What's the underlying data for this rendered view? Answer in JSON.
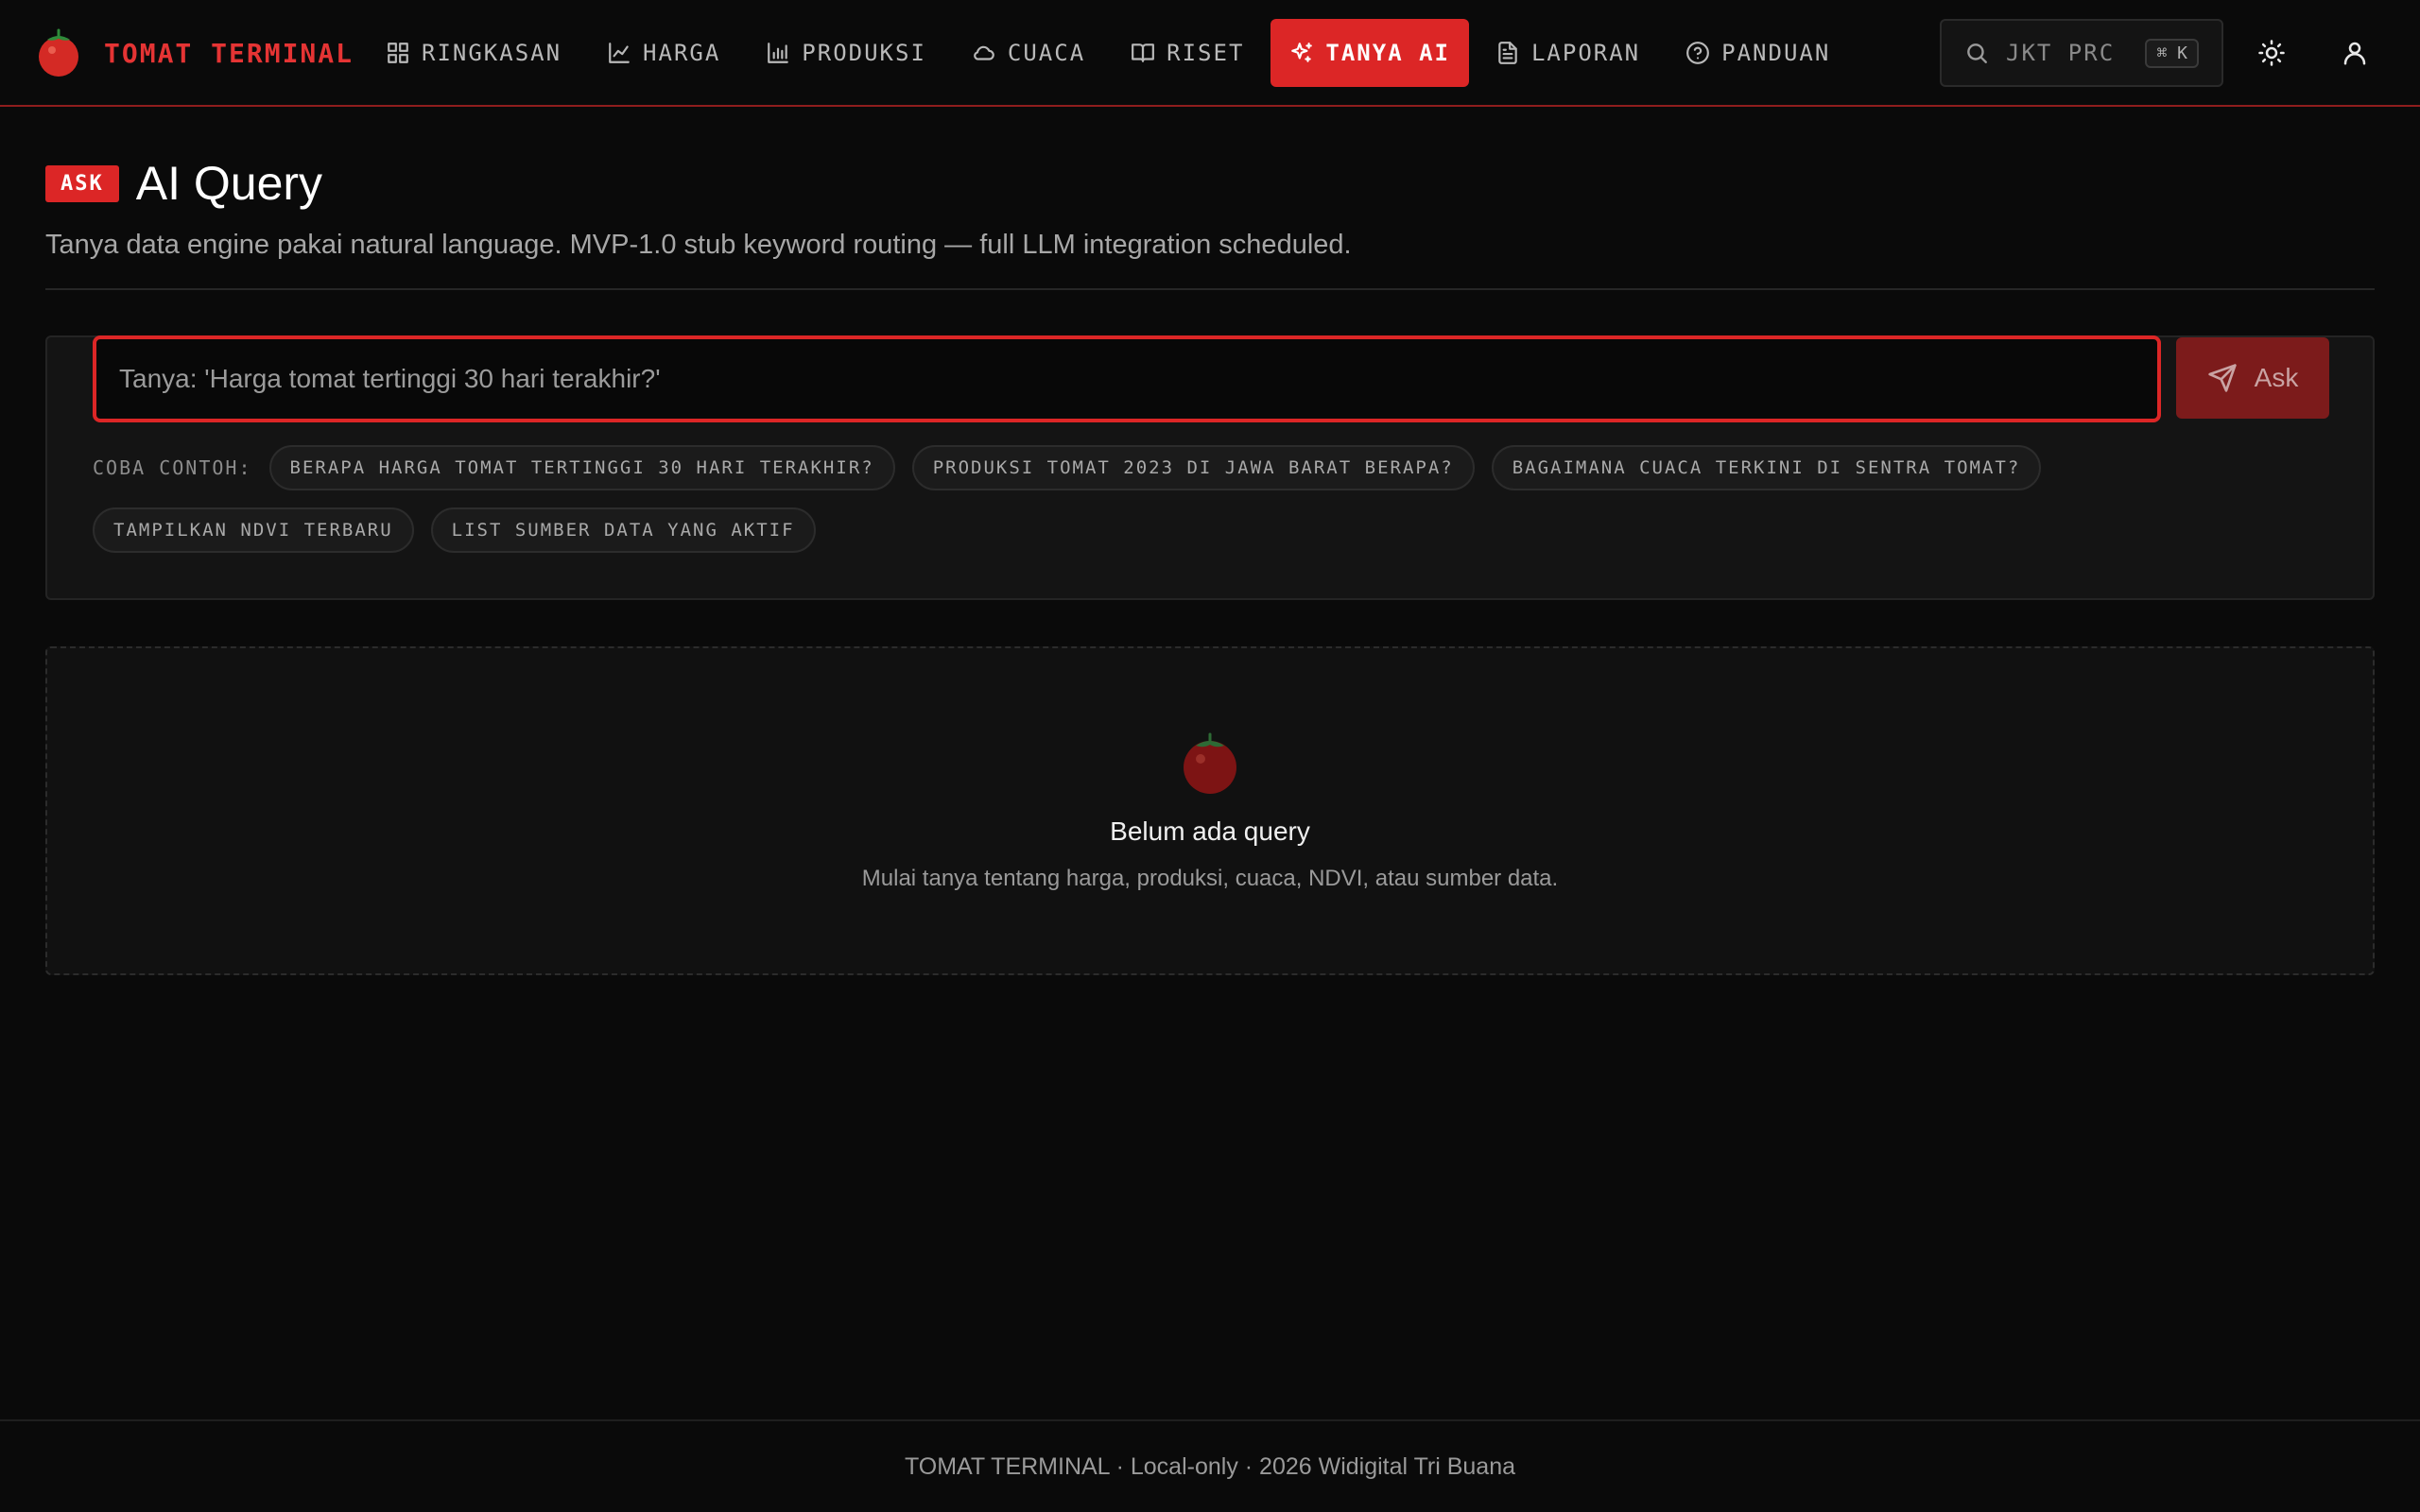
{
  "brand": {
    "name": "TOMAT TERMINAL",
    "icon": "tomato-icon",
    "color": "#e53434"
  },
  "nav": {
    "items": [
      {
        "label": "RINGKASAN",
        "icon": "grid-icon"
      },
      {
        "label": "HARGA",
        "icon": "line-chart-icon"
      },
      {
        "label": "PRODUKSI",
        "icon": "bar-chart-icon"
      },
      {
        "label": "CUACA",
        "icon": "cloud-icon"
      },
      {
        "label": "RISET",
        "icon": "book-icon"
      },
      {
        "label": "TANYA AI",
        "icon": "sparkles-icon",
        "active": true
      },
      {
        "label": "LAPORAN",
        "icon": "file-text-icon"
      },
      {
        "label": "PANDUAN",
        "icon": "help-circle-icon"
      }
    ],
    "active_color": "#dc2626"
  },
  "search": {
    "placeholder": "JKT PRC",
    "shortcut": "⌘ K"
  },
  "header": {
    "badge": "ASK",
    "title": "AI Query",
    "subtitle": "Tanya data engine pakai natural language. MVP-1.0 stub keyword routing — full LLM integration scheduled."
  },
  "ask": {
    "placeholder": "Tanya: 'Harga tomat tertinggi 30 hari terakhir?'",
    "value": "",
    "button_label": "Ask",
    "examples_label": "COBA CONTOH:",
    "examples": [
      "BERAPA HARGA TOMAT TERTINGGI 30 HARI TERAKHIR?",
      "PRODUKSI TOMAT 2023 DI JAWA BARAT BERAPA?",
      "BAGAIMANA CUACA TERKINI DI SENTRA TOMAT?",
      "TAMPILKAN NDVI TERBARU",
      "LIST SUMBER DATA YANG AKTIF"
    ]
  },
  "empty_state": {
    "title": "Belum ada query",
    "subtitle": "Mulai tanya tentang harga, produksi, cuaca, NDVI, atau sumber data."
  },
  "footer": {
    "text": "TOMAT TERMINAL · Local-only · 2026 Widigital Tri Buana"
  }
}
